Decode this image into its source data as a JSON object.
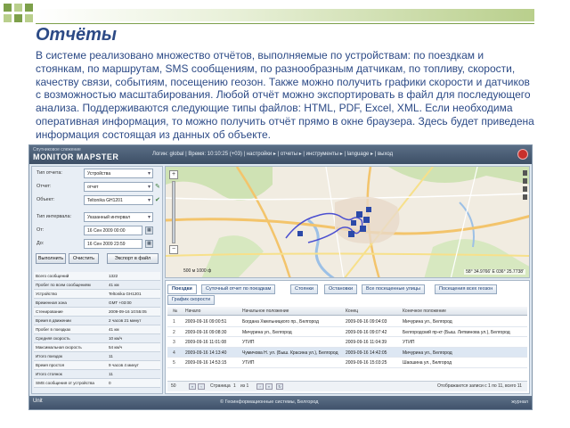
{
  "slide": {
    "title": "Отчёты",
    "paragraph": "В системе реализовано множество отчётов, выполняемые по устройствам: по поездкам и стоянкам, по маршрутам, SMS сообщениям, по разнообразным датчикам, по топливу, скорости, качеству связи, событиям, посещению геозон. Также можно получить графики скорости и датчиков с возможностью масштабирования. Любой отчёт можно экспортировать в файл для последующего анализа. Поддерживаются следующие типы файлов: HTML, PDF, Excel, XML. Если необходима оперативная информация, то можно получить отчёт прямо в окне браузера. Здесь будет приведена информация состоящая из данных об объекте."
  },
  "app": {
    "logo_top": "Спутниковое слежение",
    "logo_main": "MONITOR MAPSTER",
    "topnav": "Логин: global  |  Время: 10:10:25 (+03)  |  настройки ▸  |  отчеты ▸  |  инструменты ▸  |  language ▸  |  выход",
    "form": {
      "report_type_label": "Тип отчета:",
      "report_type_value": "Устройства",
      "report_label": "Отчет:",
      "report_value": "отчет",
      "object_label": "Объект:",
      "object_value": "Teltonika GH1201",
      "interval_type_label": "Тип интервала:",
      "interval_type_value": "Указанный интервал",
      "from_label": "От:",
      "from_value": "16 Сен 2009 00:00",
      "to_label": "До:",
      "to_value": "16 Сен 2009 23:59",
      "execute_button": "Выполнить",
      "clear_button": "Очистить",
      "export_button": "Экспорт в файл"
    },
    "info_rows": [
      {
        "k": "Всего сообщений",
        "v": "1322"
      },
      {
        "k": "Пробег по всем сообщениям",
        "v": "41 км"
      },
      {
        "k": "Устройство",
        "v": "Teltonika GH1201"
      },
      {
        "k": "Временная зона",
        "v": "GMT +03:00"
      },
      {
        "k": "Стенирование",
        "v": "2009-09-16 10:55:05"
      },
      {
        "k": "Время в движении",
        "v": "2 часов 21 минут"
      },
      {
        "k": "Пробег в поездках",
        "v": "41 км"
      },
      {
        "k": "Средняя скорость",
        "v": "10 км/ч"
      },
      {
        "k": "Максимальная скорость",
        "v": "54 км/ч"
      },
      {
        "k": "Итого поездок",
        "v": "11"
      },
      {
        "k": "Время простоя",
        "v": "9 часов 4 минут"
      },
      {
        "k": "Итого стоянок",
        "v": "11"
      },
      {
        "k": "SMS сообщения от устройства",
        "v": "0"
      }
    ],
    "map": {
      "zoom_in": "+",
      "zoom_out": "−",
      "coords": "58° 34.9766' E  036° 25.7738'",
      "scale": "500 м   1000 ф"
    },
    "tabs": [
      "Поездки",
      "Суточный отчет по поездкам",
      "Стоянки",
      "Остановки",
      "Все посещенные улицы",
      "Посещения всех геозон",
      "График скорости"
    ],
    "table": {
      "headers": [
        "№",
        "Начало",
        "Начальное положение",
        "Конец",
        "Конечное положение"
      ],
      "rows": [
        [
          "1",
          "2009-09-16 09:00:51",
          "Богдана Хмельницкого пр., Белгород",
          "2009-09-16 09:04:03",
          "Мичурина ул., Белгород"
        ],
        [
          "2",
          "2009-09-16 09:08:30",
          "Мичурина ул., Белгород",
          "2009-09-16 09:07:42",
          "Белгородский пр-кт (Быш. Литвинова ул.), Белгород"
        ],
        [
          "3",
          "2009-09-16 11:01:08",
          "УТИП",
          "2009-09-16 11:04:39",
          "УТИП"
        ],
        [
          "4",
          "2009-09-16 14:13:40",
          "Чумичова Н. ул. (Быш. Красина ул.), Белгород",
          "2009-09-16 14:42:05",
          "Мичурина ул., Белгород"
        ],
        [
          "5",
          "2009-09-16 14:53:15",
          "УТИП",
          "2009-09-16 15:03:25",
          "Шаошина ул., Белгород"
        ]
      ]
    },
    "pager": {
      "page_size": "50",
      "page_label": "Страница",
      "page_value": "1",
      "of_label": "из 1",
      "status": "Отображаются записи с 1 по 11, всего 11"
    },
    "bottombar": {
      "left": "Unit",
      "mid": "© Геоинформационные системы, Белгород",
      "right": "журнал"
    },
    "colors": {
      "accent": "#2c4a86",
      "header": "#4a5d75",
      "track": "#4b4fd0"
    }
  }
}
